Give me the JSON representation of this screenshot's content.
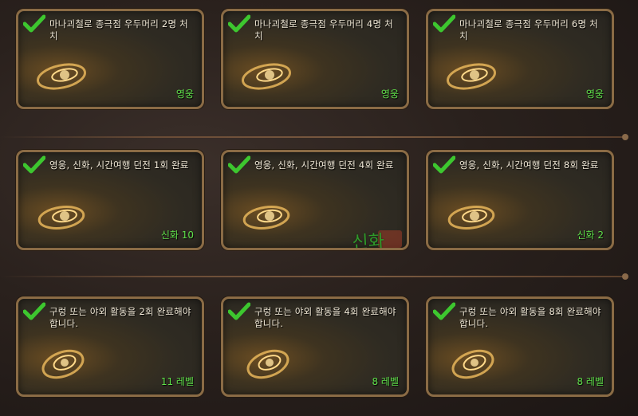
{
  "colors": {
    "card_border": "#8a6b45",
    "title_text": "#f2ead8",
    "reward_text": "#5fe04a",
    "check": "#3dc72f",
    "handwriting": "#2f9a2a"
  },
  "rows": [
    {
      "cards": [
        {
          "title": "마나괴철로 종극점 우두머리 2명 처치",
          "reward": "영웅",
          "completed": true,
          "icon": "check-icon"
        },
        {
          "title": "마나괴철로 종극점 우두머리 4명 처치",
          "reward": "영웅",
          "completed": true,
          "icon": "check-icon"
        },
        {
          "title": "마나괴철로 종극점 우두머리 6명 처치",
          "reward": "영웅",
          "completed": true,
          "icon": "check-icon"
        }
      ]
    },
    {
      "cards": [
        {
          "title": "영웅, 신화, 시간여행 던전 1회 완료",
          "reward": "신화 10",
          "completed": true,
          "icon": "check-icon"
        },
        {
          "title": "영웅, 신화, 시간여행 던전 4회 완료",
          "reward": "",
          "completed": true,
          "icon": "check-icon",
          "handwritten_note": "신화 10"
        },
        {
          "title": "영웅, 신화, 시간여행 던전 8회 완료",
          "reward": "신화 2",
          "completed": true,
          "icon": "check-icon"
        }
      ]
    },
    {
      "cards": [
        {
          "title": "구렁 또는 야외 활동을 2회 완료해야 합니다.",
          "reward": "11 레벨",
          "completed": true,
          "icon": "check-icon"
        },
        {
          "title": "구렁 또는 야외 활동을 4회 완료해야 합니다.",
          "reward": "8 레벨",
          "completed": true,
          "icon": "check-icon"
        },
        {
          "title": "구렁 또는 야외 활동을 8회 완료해야 합니다.",
          "reward": "8 레벨",
          "completed": true,
          "icon": "check-icon"
        }
      ]
    }
  ]
}
